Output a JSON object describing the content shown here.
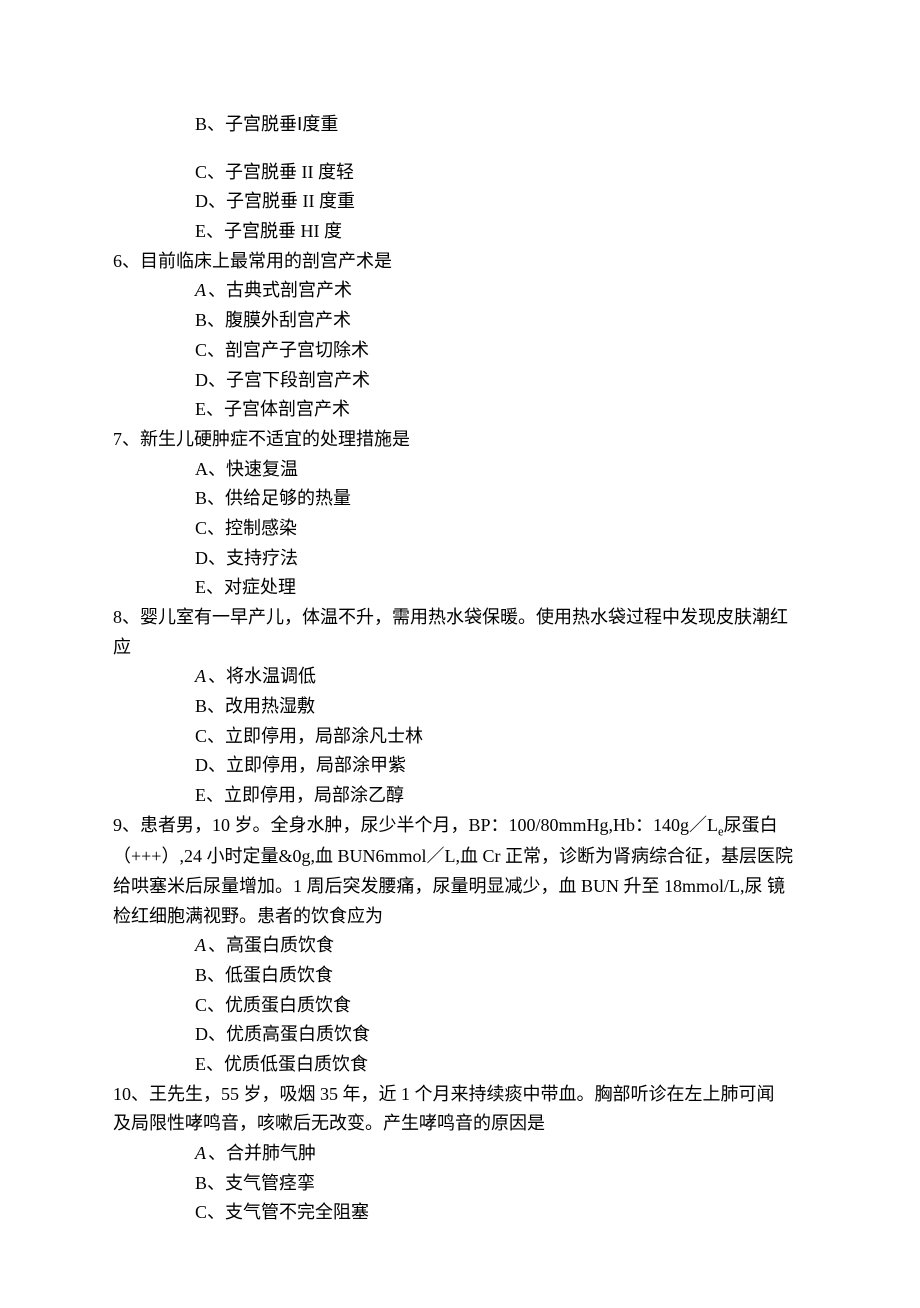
{
  "q5_tail_options": [
    {
      "letter": "B",
      "text": "子宫脱垂Ⅰ度重"
    },
    {
      "letter": "C",
      "text": "子宫脱垂 II 度轻"
    },
    {
      "letter": "D",
      "text": "子宫脱垂 II 度重"
    },
    {
      "letter": "E",
      "text": "子宫脱垂 HI 度"
    }
  ],
  "q6": {
    "stem": "6、目前临床上最常用的剖宫产术是",
    "options": [
      {
        "letter": "A",
        "italic": true,
        "text": "古典式剖宫产术"
      },
      {
        "letter": "B",
        "text": "腹膜外刮宫产术"
      },
      {
        "letter": "C",
        "text": "剖宫产子宫切除术"
      },
      {
        "letter": "D",
        "text": "子宫下段剖宫产术"
      },
      {
        "letter": "E",
        "text": "子宫体剖宫产术"
      }
    ]
  },
  "q7": {
    "stem": "7、新生儿硬肿症不适宜的处理措施是",
    "options": [
      {
        "letter": "A",
        "text": "快速复温"
      },
      {
        "letter": "B",
        "text": "供给足够的热量"
      },
      {
        "letter": "C",
        "text": "控制感染"
      },
      {
        "letter": "D",
        "text": "支持疗法"
      },
      {
        "letter": "E",
        "text": "对症处理"
      }
    ]
  },
  "q8": {
    "stem_l1": "8、婴儿室有一早产儿，体温不升，需用热水袋保暖。使用热水袋过程中发现皮肤潮红",
    "stem_l2": "应",
    "options": [
      {
        "letter": "A",
        "italic": true,
        "text": "将水温调低"
      },
      {
        "letter": "B",
        "text": "改用热湿敷"
      },
      {
        "letter": "C",
        "text": "立即停用，局部涂凡士林"
      },
      {
        "letter": "D",
        "text": "立即停用，局部涂甲紫"
      },
      {
        "letter": "E",
        "text": "立即停用，局部涂乙醇"
      }
    ]
  },
  "q9": {
    "stem_l1_pre": "9、患者男，10 岁。全身水肿，尿少半个月，BP：100/80mmHg,Hb：140g／L",
    "stem_l1_sub": "e",
    "stem_l1_post": "尿蛋白",
    "stem_l2": "（+++）,24 小时定量&0g,血 BUN6mmol／L,血 Cr 正常，诊断为肾病综合征，基层医院",
    "stem_l3": "给哄塞米后尿量增加。1 周后突发腰痛，尿量明显减少，血 BUN 升至 18mmol/L,尿 镜",
    "stem_l4": "检红细胞满视野。患者的饮食应为",
    "options": [
      {
        "letter": "A",
        "italic": true,
        "text": "高蛋白质饮食"
      },
      {
        "letter": "B",
        "text": "低蛋白质饮食"
      },
      {
        "letter": "C",
        "text": "优质蛋白质饮食"
      },
      {
        "letter": "D",
        "text": "优质高蛋白质饮食"
      },
      {
        "letter": "E",
        "text": "优质低蛋白质饮食"
      }
    ]
  },
  "q10": {
    "stem_l1": "10、王先生，55 岁，吸烟 35 年，近 1 个月来持续痰中带血。胸部听诊在左上肺可闻",
    "stem_l2": "及局限性哮鸣音，咳嗽后无改变。产生哮鸣音的原因是",
    "options": [
      {
        "letter": "A",
        "italic": true,
        "text": "合并肺气肿"
      },
      {
        "letter": "B",
        "text": "支气管痉挛"
      },
      {
        "letter": "C",
        "text": "支气管不完全阻塞"
      }
    ]
  }
}
